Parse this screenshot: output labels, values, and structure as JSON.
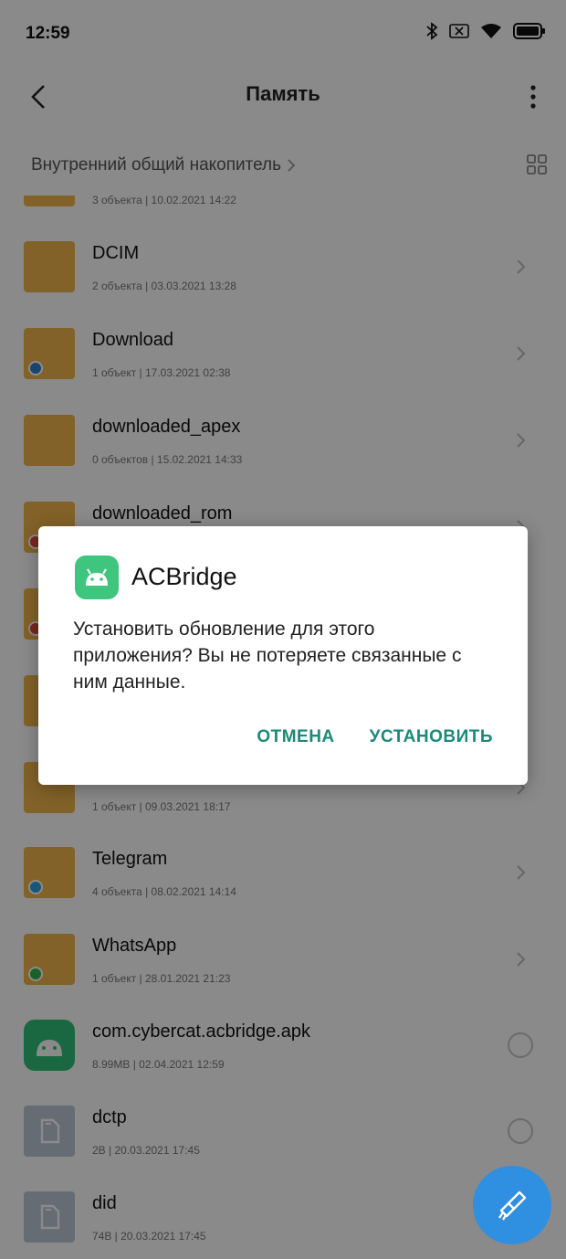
{
  "status_bar": {
    "time": "12:59"
  },
  "app_bar": {
    "title": "Память"
  },
  "breadcrumb": {
    "label": "Внутренний общий накопитель"
  },
  "files": [
    {
      "name": "",
      "meta": "3 объекта  |  10.02.2021 14:22",
      "type": "folder",
      "badge": ""
    },
    {
      "name": "DCIM",
      "meta": "2 объекта  |  03.03.2021 13:28",
      "type": "folder",
      "badge": ""
    },
    {
      "name": "Download",
      "meta": "1 объект  |  17.03.2021 02:38",
      "type": "folder",
      "badge": "#2f7fd0"
    },
    {
      "name": "downloaded_apex",
      "meta": "0 объектов  |  15.02.2021 14:33",
      "type": "folder",
      "badge": ""
    },
    {
      "name": "downloaded_rom",
      "meta": "",
      "type": "folder",
      "badge": "#e04a3a"
    },
    {
      "name": "",
      "meta": "",
      "type": "folder",
      "badge": "#e04a3a"
    },
    {
      "name": "",
      "meta": "",
      "type": "folder",
      "badge": ""
    },
    {
      "name": "",
      "meta": "1 объект  |  09.03.2021 18:17",
      "type": "folder",
      "badge": ""
    },
    {
      "name": "Telegram",
      "meta": "4 объекта  |  08.02.2021 14:14",
      "type": "folder",
      "badge": "#2f9be0"
    },
    {
      "name": "WhatsApp",
      "meta": "1 объект  |  28.01.2021 21:23",
      "type": "folder",
      "badge": "#2fb34a"
    },
    {
      "name": "com.cybercat.acbridge.apk",
      "meta": "8.99MB  |  02.04.2021 12:59",
      "type": "apk",
      "badge": ""
    },
    {
      "name": "dctp",
      "meta": "2B  |  20.03.2021 17:45",
      "type": "file",
      "badge": ""
    },
    {
      "name": "did",
      "meta": "74B  |  20.03.2021 17:45",
      "type": "file",
      "badge": ""
    }
  ],
  "dialog": {
    "app_name": "ACBridge",
    "message": "Установить обновление для этого приложения? Вы не потеряете связанные с ним данные.",
    "cancel_label": "ОТМЕНА",
    "install_label": "УСТАНОВИТЬ"
  },
  "colors": {
    "accent": "#1a8a7a",
    "folder": "#f1b54a",
    "fab": "#2f8fe0",
    "android_green": "#3ec67f"
  }
}
